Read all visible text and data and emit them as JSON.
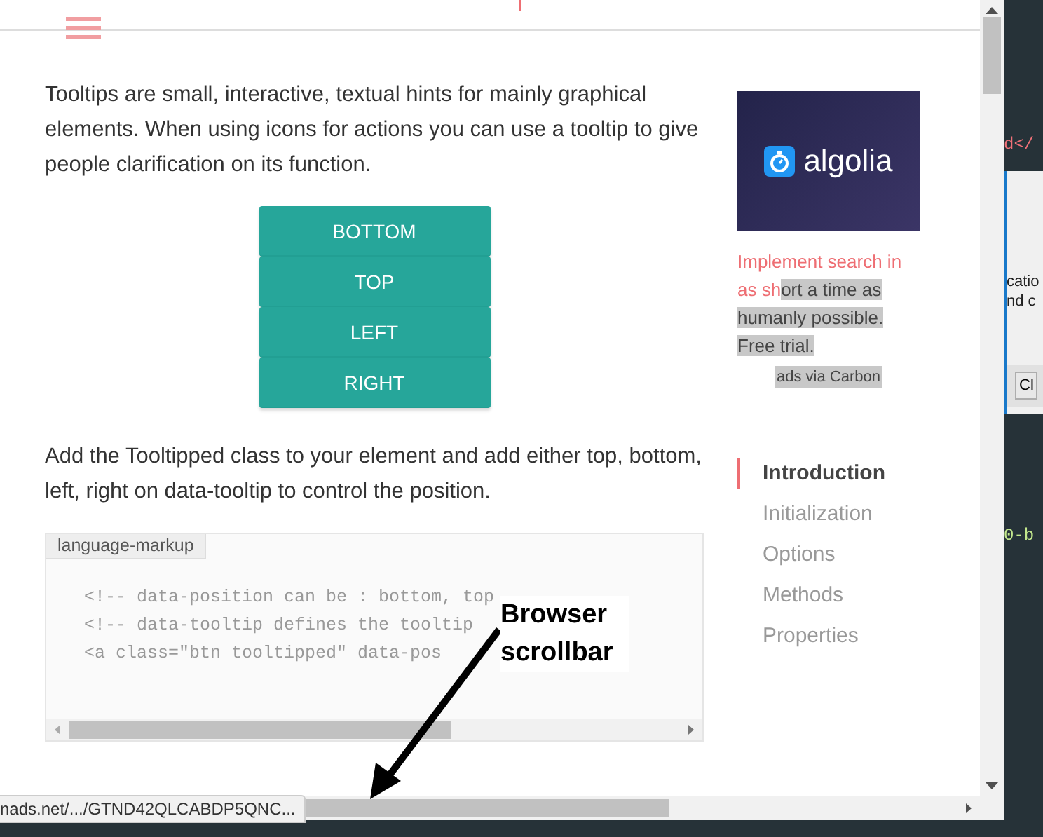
{
  "main": {
    "intro": "Tooltips are small, interactive, textual hints for mainly graphical elements. When using icons for actions you can use a tooltip to give people clarification on its function.",
    "buttons": [
      "BOTTOM",
      "TOP",
      "LEFT",
      "RIGHT"
    ],
    "instruction": "Add the Tooltipped class to your element and add either top, bottom, left, right on data-tooltip to control the position.",
    "code_block": {
      "language": "language-markup",
      "lines": [
        "<!-- data-position can be : bottom, top",
        "<!-- data-tooltip defines the tooltip",
        "<a class=\"btn tooltipped\" data-pos"
      ]
    }
  },
  "ad": {
    "logo_text": "algolia",
    "text_plain": "Implement search in as sh",
    "text_selected": "ort a time as humanly possible. Free trial.",
    "credit": "ads via Carbon"
  },
  "toc": [
    {
      "label": "Introduction",
      "selected": true
    },
    {
      "label": "Initialization",
      "selected": false
    },
    {
      "label": "Options",
      "selected": false
    },
    {
      "label": "Methods",
      "selected": false
    },
    {
      "label": "Properties",
      "selected": false
    }
  ],
  "status_url": "nads.net/.../GTND42QLCABDP5QNC...",
  "annotation": "Browser scrollbar",
  "background_window": {
    "code_top": "d</",
    "dialog_lines": [
      "catio",
      "nd c"
    ],
    "dialog_button": "Cl",
    "code_bottom": "0-b"
  }
}
